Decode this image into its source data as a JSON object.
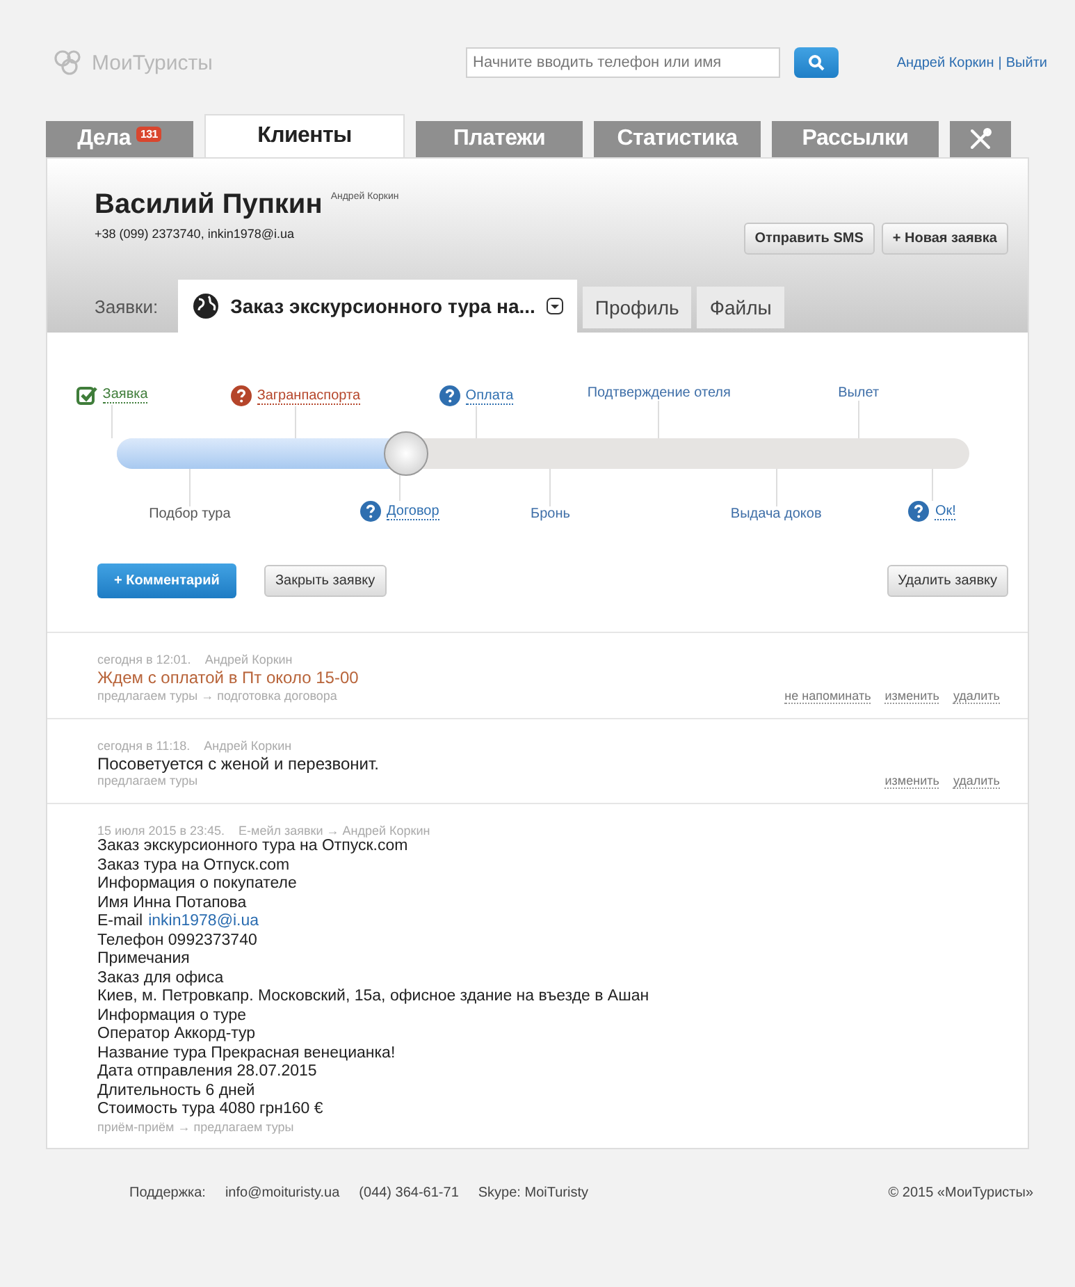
{
  "header": {
    "logo": "МоиТуристы",
    "search": {
      "placeholder": "Начните вводить телефон или имя"
    },
    "user": {
      "name": "Андрей Коркин",
      "separator": "|",
      "logout": "Выйти"
    }
  },
  "nav_tabs": [
    {
      "kind": "text",
      "label": "Дела",
      "badge": "131",
      "selected": false
    },
    {
      "kind": "text",
      "label": "Клиенты",
      "selected": true
    },
    {
      "kind": "text",
      "label": "Платежи",
      "selected": false
    },
    {
      "kind": "text",
      "label": "Статистика",
      "selected": false
    },
    {
      "kind": "text",
      "label": "Рассылки",
      "selected": false
    },
    {
      "kind": "tools",
      "selected": false
    }
  ],
  "client": {
    "name": "Василий Пупкин",
    "manager": "Андрей Коркин",
    "contacts": "+38 (099) 2373740, inkin1978@i.ua",
    "buttons": [
      "Отправить SMS",
      "+ Новая заявка"
    ]
  },
  "sub_tabs": {
    "label": "Заявки:",
    "tabs": [
      {
        "kind": "order",
        "label": "Заказ экскурсионного тура на...",
        "selected": true
      },
      {
        "kind": "text",
        "label": "Профиль",
        "selected": false
      },
      {
        "kind": "text",
        "label": "Файлы",
        "selected": false
      }
    ]
  },
  "progress": {
    "level": 0.34,
    "stages": [
      {
        "label": "Заявка",
        "kind": "done"
      },
      {
        "label": "Подбор тура",
        "kind": "passed"
      },
      {
        "label": "Загранпаспорта",
        "kind": "problem"
      },
      {
        "label": "Договор",
        "kind": "question"
      },
      {
        "label": "Оплата",
        "kind": "question"
      },
      {
        "label": "Бронь",
        "kind": "pending"
      },
      {
        "label": "Подтверждение отеля",
        "kind": "pending"
      },
      {
        "label": "Выдача доков",
        "kind": "pending"
      },
      {
        "label": "Вылет",
        "kind": "pending"
      },
      {
        "label": "Ок!",
        "kind": "question"
      }
    ]
  },
  "actions": {
    "comment": "+ Комментарий",
    "close": "Закрыть заявку",
    "delete": "Удалить заявку"
  },
  "comments": [
    {
      "kind": "reminder",
      "time": "сегодня в 12:01.",
      "author": "Андрей Коркин",
      "lines": [
        {
          "text": "Ждем с оплатой в Пт около 15-00"
        }
      ],
      "trail": "предлагаем туры → подготовка договора",
      "links": [
        "не напоминать",
        "изменить",
        "удалить"
      ]
    },
    {
      "kind": "note",
      "time": "сегодня в 11:18.",
      "author": "Андрей Коркин",
      "lines": [
        {
          "text": "Посоветуется с женой и перезвонит."
        }
      ],
      "trail": "предлагаем туры",
      "links": [
        "изменить",
        "удалить"
      ]
    },
    {
      "kind": "email",
      "time": "15 июля 2015 в 23:45.",
      "author": "E-мейл заявки → Андрей Коркин",
      "lines": [
        {
          "text": "Заказ экскурсионного тура на Отпуск.com"
        },
        {
          "text": "Заказ тура на Отпуск.com"
        },
        {
          "text": "Информация о покупателе"
        },
        {
          "text": "Имя Инна Потапова"
        },
        {
          "text": "E-mail",
          "link": "inkin1978@i.ua"
        },
        {
          "text": "Телефон 0992373740"
        },
        {
          "text": "Примечания"
        },
        {
          "text": "Заказ для офиса"
        },
        {
          "text": "Киев, м. Петровкапр. Московский, 15а, офисное здание на въезде в Ашан"
        },
        {
          "text": "Информация о туре"
        },
        {
          "text": "Оператор Аккорд-тур"
        },
        {
          "text": "Название тура Прекрасная венецианка!"
        },
        {
          "text": "Дата отправления 28.07.2015"
        },
        {
          "text": "Длительность 6 дней"
        },
        {
          "text": "Стоимость тура 4080 грн160 €"
        }
      ],
      "trail": "приём-приём → предлагаем туры"
    }
  ],
  "footer": {
    "support_label": "Поддержка:",
    "email": "info@moituristy.ua",
    "phone": "(044) 364-61-71",
    "skype": "Skype: MoiTuristy",
    "copyright": "© 2015 «МоиТуристы»"
  }
}
